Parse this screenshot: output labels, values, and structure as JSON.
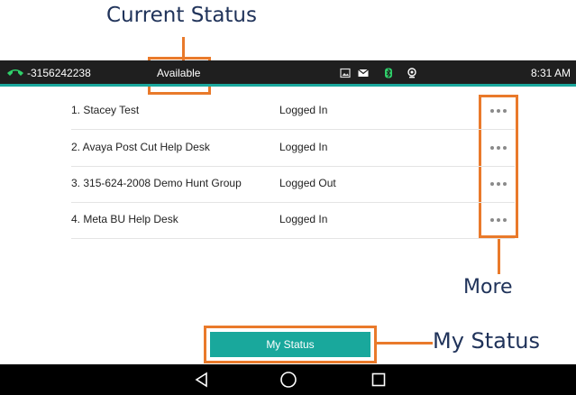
{
  "annotations": {
    "current_status": "Current Status",
    "more": "More",
    "my_status": "My Status"
  },
  "status_bar": {
    "phone_number": "3156242238",
    "availability": "Available",
    "time": "8:31 AM",
    "icons": [
      "phone-handset-icon",
      "image-icon",
      "mail-icon",
      "bluetooth-icon",
      "location-icon"
    ],
    "accent_color": "#1aa89d"
  },
  "queues": [
    {
      "name": "1. Stacey Test",
      "status": "Logged In"
    },
    {
      "name": "2. Avaya Post Cut Help Desk",
      "status": "Logged In"
    },
    {
      "name": "3. 315-624-2008 Demo Hunt Group",
      "status": "Logged Out"
    },
    {
      "name": "4. Meta BU Help Desk",
      "status": "Logged In"
    }
  ],
  "my_status_button": {
    "label": "My Status",
    "color": "#19a89c"
  },
  "nav_bar": {
    "icons": [
      "back-icon",
      "home-icon",
      "recents-icon"
    ]
  },
  "callout_color": "#e97a2b"
}
